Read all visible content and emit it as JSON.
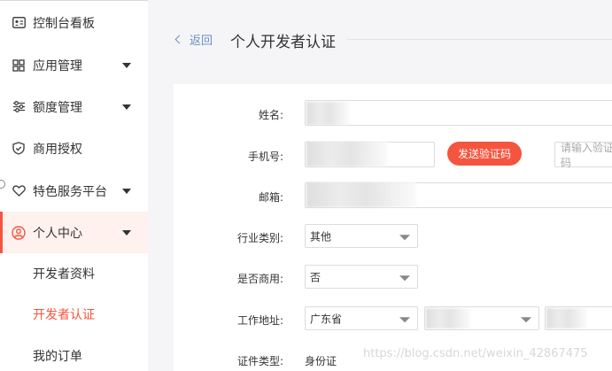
{
  "sidebar": {
    "items": [
      {
        "label": "控制台看板",
        "icon": "dashboard-icon"
      },
      {
        "label": "应用管理",
        "icon": "grid-icon"
      },
      {
        "label": "额度管理",
        "icon": "sliders-icon"
      },
      {
        "label": "商用授权",
        "icon": "shield-check-icon"
      },
      {
        "label": "特色服务平台",
        "icon": "heart-icon"
      },
      {
        "label": "个人中心",
        "icon": "user-circle-icon"
      }
    ],
    "sub_items": [
      {
        "label": "开发者资料"
      },
      {
        "label": "开发者认证"
      },
      {
        "label": "我的订单"
      }
    ]
  },
  "header": {
    "back_label": "返回",
    "title": "个人开发者认证"
  },
  "form": {
    "name_label": "姓名:",
    "phone_label": "手机号:",
    "send_code_button": "发送验证码",
    "code_placeholder": "请输入验证码",
    "email_label": "邮箱:",
    "industry_label": "行业类别:",
    "industry_value": "其他",
    "commercial_label": "是否商用:",
    "commercial_value": "否",
    "address_label": "工作地址:",
    "province_value": "广东省",
    "id_type_label": "证件类型:",
    "id_type_value": "身份证"
  },
  "watermark": "https://blog.csdn.net/weixin_42867475",
  "colors": {
    "accent": "#f5553e",
    "active_bg": "#fff1ee",
    "link": "#6b8ec7",
    "page_bg": "#f5f5f7"
  }
}
